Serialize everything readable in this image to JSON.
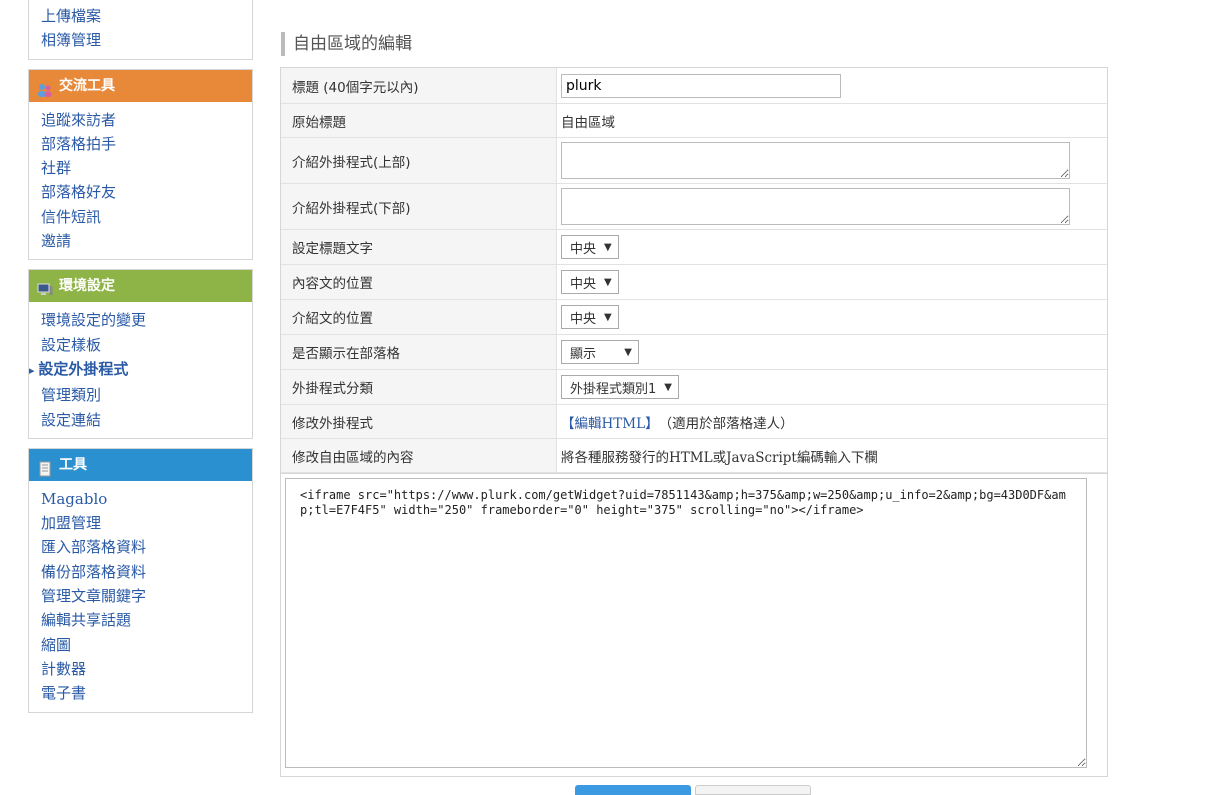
{
  "sidebar": {
    "top_links": [
      "上傳檔案",
      "相簿管理"
    ],
    "sections": [
      {
        "title": "交流工具",
        "color": "#e8893a",
        "icon": "people-icon",
        "links": [
          "追蹤來訪者",
          "部落格拍手",
          "社群",
          "部落格好友",
          "信件短訊",
          "邀請"
        ]
      },
      {
        "title": "環境設定",
        "color": "#8eb346",
        "icon": "monitor-icon",
        "links": [
          "環境設定的變更",
          "設定樣板",
          "設定外掛程式",
          "管理類別",
          "設定連結"
        ],
        "current": "設定外掛程式"
      },
      {
        "title": "工具",
        "color": "#2b90cf",
        "icon": "document-icon",
        "links": [
          "Magablo",
          "加盟管理",
          "匯入部落格資料",
          "備份部落格資料",
          "管理文章關鍵字",
          "編輯共享話題",
          "縮圖",
          "計數器",
          "電子書"
        ]
      }
    ]
  },
  "main": {
    "title": "自由區域的編輯",
    "rows": {
      "title_label": "標題 (40個字元以內)",
      "title_value": "plurk",
      "original_title_label": "原始標題",
      "original_title_value": "自由區域",
      "intro_top_label": "介紹外掛程式(上部)",
      "intro_bottom_label": "介紹外掛程式(下部)",
      "title_text_label": "設定標題文字",
      "title_text_value": "中央",
      "content_pos_label": "內容文的位置",
      "content_pos_value": "中央",
      "intro_pos_label": "介紹文的位置",
      "intro_pos_value": "中央",
      "show_label": "是否顯示在部落格",
      "show_value": "顯示",
      "category_label": "外掛程式分類",
      "category_value": "外掛程式類別1",
      "edit_plugin_label": "修改外掛程式",
      "edit_plugin_link": "【編輯HTML】",
      "edit_plugin_note": "（適用於部落格達人）",
      "content_label": "修改自由區域的內容",
      "content_note": "將各種服務發行的HTML或JavaScript編碼輸入下欄"
    },
    "code": "<iframe src=\"https://www.plurk.com/getWidget?uid=7851143&amp;h=375&amp;w=250&amp;u_info=2&amp;bg=43D0DF&amp;tl=E7F4F5\" width=\"250\" frameborder=\"0\" height=\"375\" scrolling=\"no\"></iframe>"
  }
}
